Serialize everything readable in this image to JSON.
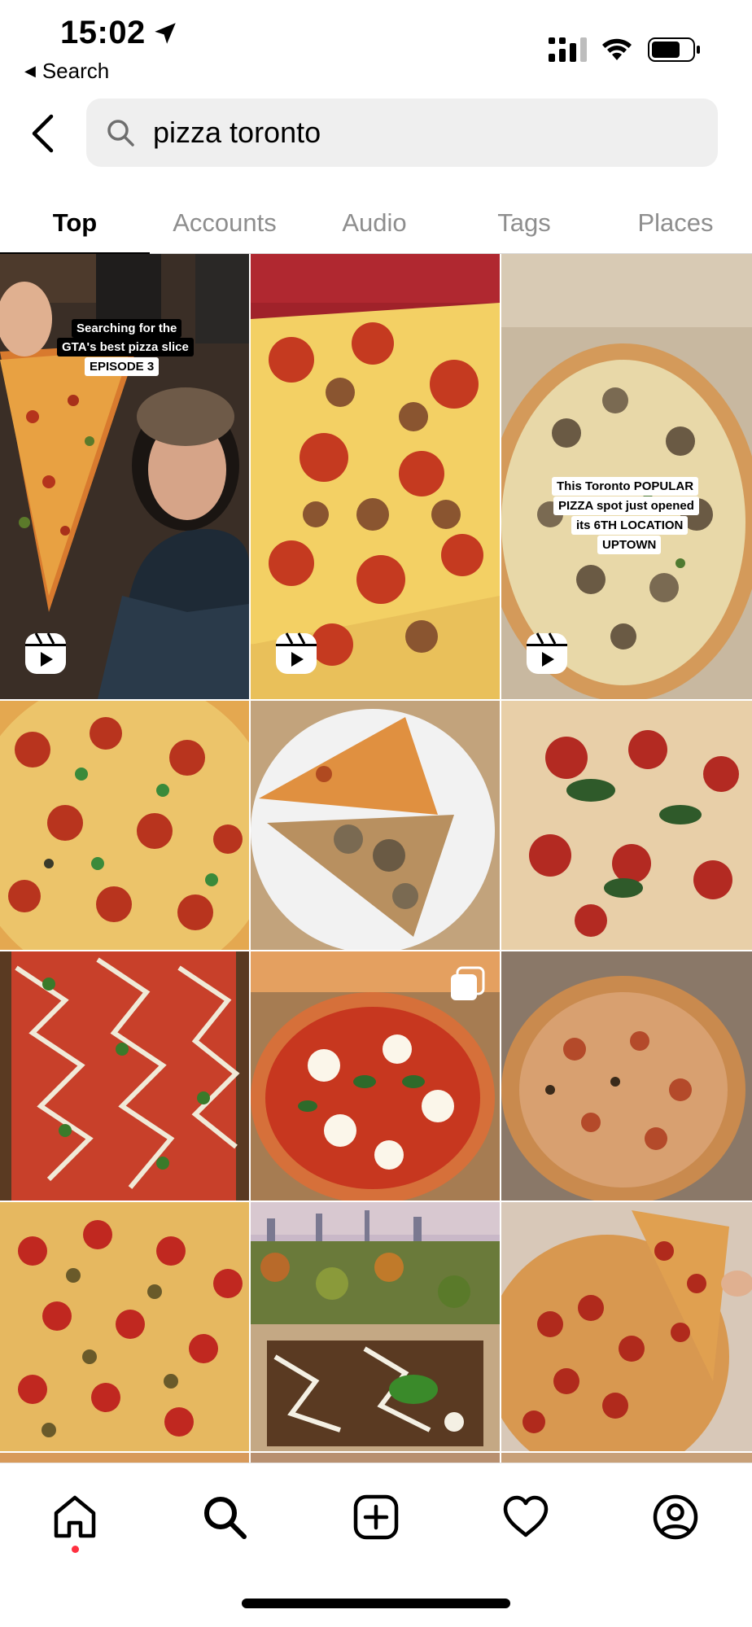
{
  "status_bar": {
    "time": "15:02",
    "back_app_label": "Search"
  },
  "search": {
    "query": "pizza toronto",
    "back_icon": "chevron-left-icon",
    "search_icon": "search-icon"
  },
  "tabs": [
    {
      "label": "Top",
      "active": true
    },
    {
      "label": "Accounts",
      "active": false
    },
    {
      "label": "Audio",
      "active": false
    },
    {
      "label": "Tags",
      "active": false
    },
    {
      "label": "Places",
      "active": false
    }
  ],
  "grid": {
    "tile_1": {
      "caption_line1": "Searching for the",
      "caption_line2": "GTA's best pizza slice",
      "caption_line3": "EPISODE 3",
      "icon": "reel-icon"
    },
    "tile_2": {
      "icon": "reel-icon"
    },
    "tile_3": {
      "caption_line1": "This Toronto POPULAR",
      "caption_line2": "PIZZA spot just opened",
      "caption_line3": "its 6TH LOCATION",
      "caption_line4": "UPTOWN",
      "icon": "reel-icon"
    },
    "tile_8": {
      "icon": "multiple-posts-icon"
    }
  },
  "bottom_nav": {
    "items": [
      "home-icon",
      "search-icon",
      "create-icon",
      "heart-icon",
      "profile-icon"
    ],
    "active": "home-icon",
    "notification_dot_color": "#ff3040"
  }
}
